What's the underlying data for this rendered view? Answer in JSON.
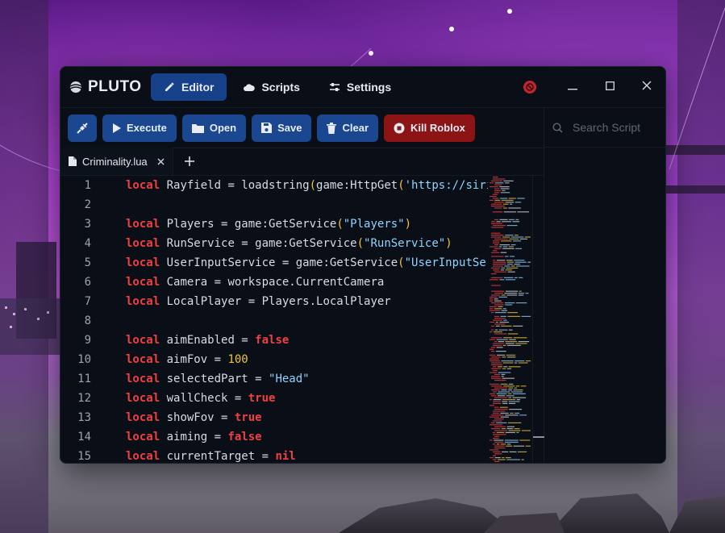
{
  "app": {
    "brand": "PLUTO",
    "nav": [
      {
        "label": "Editor",
        "icon": "edit-icon",
        "active": true
      },
      {
        "label": "Scripts",
        "icon": "cloud-icon",
        "active": false
      },
      {
        "label": "Settings",
        "icon": "sliders-icon",
        "active": false
      }
    ]
  },
  "toolbar": {
    "attach_icon": "plug-icon",
    "execute": "Execute",
    "open": "Open",
    "save": "Save",
    "clear": "Clear",
    "kill": "Kill Roblox"
  },
  "sidepanel": {
    "search_placeholder": "Search Script"
  },
  "tabs": [
    {
      "label": "Criminality.lua"
    }
  ],
  "code": [
    {
      "n": "1",
      "t": [
        [
          "kw",
          "local"
        ],
        [
          "id",
          " Rayfield = loadstring"
        ],
        [
          "paren",
          "("
        ],
        [
          "id",
          "game:HttpGet"
        ],
        [
          "paren",
          "("
        ],
        [
          "str",
          "'https://sirius.menu/rayfield'"
        ]
      ]
    },
    {
      "n": "2",
      "t": []
    },
    {
      "n": "3",
      "t": [
        [
          "kw",
          "local"
        ],
        [
          "id",
          " Players = game:GetService"
        ],
        [
          "paren",
          "("
        ],
        [
          "str",
          "\"Players\""
        ],
        [
          "paren",
          ")"
        ]
      ]
    },
    {
      "n": "4",
      "t": [
        [
          "kw",
          "local"
        ],
        [
          "id",
          " RunService = game:GetService"
        ],
        [
          "paren",
          "("
        ],
        [
          "str",
          "\"RunService\""
        ],
        [
          "paren",
          ")"
        ]
      ]
    },
    {
      "n": "5",
      "t": [
        [
          "kw",
          "local"
        ],
        [
          "id",
          " UserInputService = game:GetService"
        ],
        [
          "paren",
          "("
        ],
        [
          "str",
          "\"UserInputService\""
        ],
        [
          "paren",
          ")"
        ]
      ]
    },
    {
      "n": "6",
      "t": [
        [
          "kw",
          "local"
        ],
        [
          "id",
          " Camera = workspace.CurrentCamera"
        ]
      ]
    },
    {
      "n": "7",
      "t": [
        [
          "kw",
          "local"
        ],
        [
          "id",
          " LocalPlayer = Players.LocalPlayer"
        ]
      ]
    },
    {
      "n": "8",
      "t": []
    },
    {
      "n": "9",
      "t": [
        [
          "kw",
          "local"
        ],
        [
          "id",
          " aimEnabled = "
        ],
        [
          "kw",
          "false"
        ]
      ]
    },
    {
      "n": "10",
      "t": [
        [
          "kw",
          "local"
        ],
        [
          "id",
          " aimFov = "
        ],
        [
          "num",
          "100"
        ]
      ]
    },
    {
      "n": "11",
      "t": [
        [
          "kw",
          "local"
        ],
        [
          "id",
          " selectedPart = "
        ],
        [
          "str",
          "\"Head\""
        ]
      ]
    },
    {
      "n": "12",
      "t": [
        [
          "kw",
          "local"
        ],
        [
          "id",
          " wallCheck = "
        ],
        [
          "kw",
          "true"
        ]
      ]
    },
    {
      "n": "13",
      "t": [
        [
          "kw",
          "local"
        ],
        [
          "id",
          " showFov = "
        ],
        [
          "kw",
          "true"
        ]
      ]
    },
    {
      "n": "14",
      "t": [
        [
          "kw",
          "local"
        ],
        [
          "id",
          " aiming = "
        ],
        [
          "kw",
          "false"
        ]
      ]
    },
    {
      "n": "15",
      "t": [
        [
          "kw",
          "local"
        ],
        [
          "id",
          " currentTarget = "
        ],
        [
          "kw",
          "nil"
        ]
      ]
    }
  ],
  "colors": {
    "accent": "#16418a",
    "kill": "#8c1414",
    "keyword": "#ef4141",
    "string": "#8fd3ff",
    "number": "#f0c43a"
  }
}
